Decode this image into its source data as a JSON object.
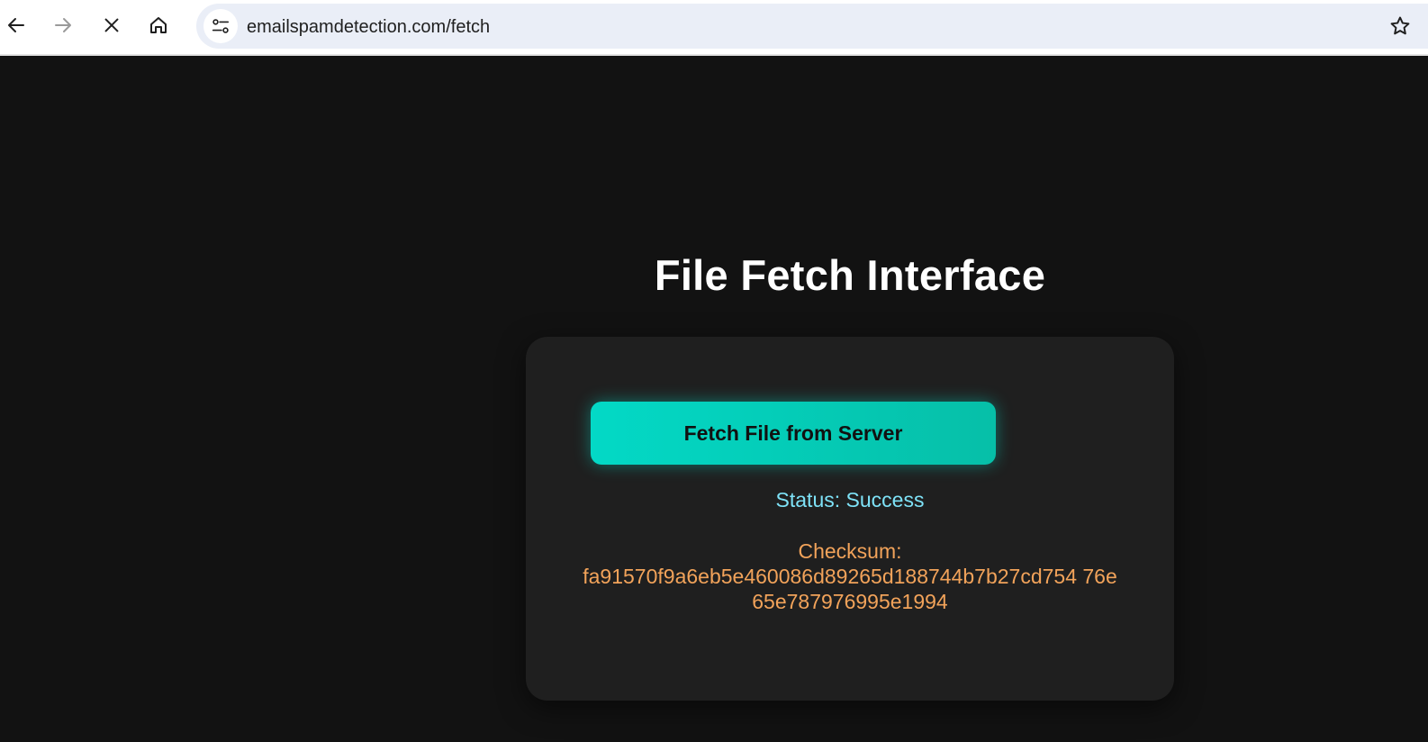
{
  "browser": {
    "url": "emailspamdetection.com/fetch",
    "icons": {
      "back": "arrow-left-icon",
      "forward": "arrow-right-icon",
      "stop": "close-icon",
      "home": "home-icon",
      "site_info": "tune-icon",
      "bookmark": "star-icon"
    }
  },
  "page": {
    "title": "File Fetch Interface",
    "fetch_button_label": "Fetch File from Server",
    "status_text": "Status: Success",
    "checksum_label": "Checksum:",
    "checksum_value": "fa91570f9a6eb5e460086d89265d188744b7b27cd754 76e65e787976995e1994"
  },
  "colors": {
    "background": "#121212",
    "card": "#1f1f1f",
    "accent": "#03d9c6",
    "status": "#7ee2f7",
    "checksum": "#f2a35a"
  }
}
